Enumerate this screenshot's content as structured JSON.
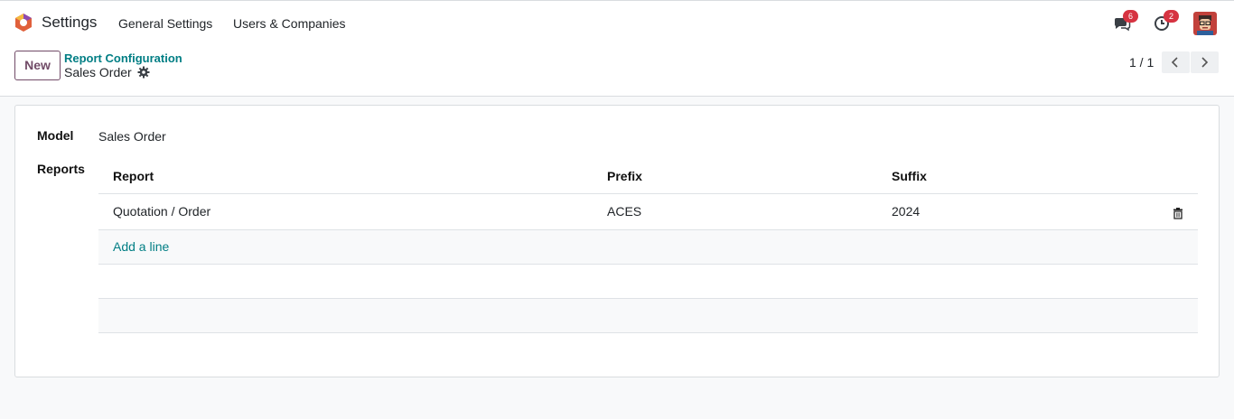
{
  "navbar": {
    "app_name": "Settings",
    "menu": [
      "General Settings",
      "Users & Companies"
    ],
    "messages_count": "6",
    "activities_count": "2"
  },
  "control": {
    "new_label": "New",
    "breadcrumb_parent": "Report Configuration",
    "breadcrumb_current": "Sales Order",
    "pager": "1 / 1"
  },
  "form": {
    "model_label": "Model",
    "model_value": "Sales Order",
    "reports_label": "Reports",
    "columns": [
      "Report",
      "Prefix",
      "Suffix"
    ],
    "rows": [
      {
        "report": "Quotation / Order",
        "prefix": "ACES",
        "suffix": "2024"
      }
    ],
    "add_line": "Add a line"
  },
  "colors": {
    "primary": "#714b67",
    "link": "#017e84",
    "badge": "#d63341"
  }
}
